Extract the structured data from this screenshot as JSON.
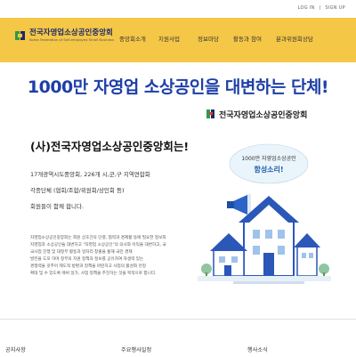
{
  "topbar": {
    "links": [
      "LOG IN",
      "|",
      "SIGN UP"
    ]
  },
  "logo": {
    "title": "전국자영업소상공인중앙회",
    "subtitle": "Korea Federation of Self-employed Small Business",
    "colors": {
      "primary": "#1b2a6b",
      "accent": "#2e9a47"
    }
  },
  "nav": {
    "background": "#f5c747",
    "items": [
      "중앙회소개",
      "지원사업",
      "정보마당",
      "활동과 참여",
      "분과위원회상담"
    ]
  },
  "hero": {
    "title": "1000만 자영업 소상공인을 대변하는 단체!",
    "title_color": "#1e3fa8",
    "org_name": "전국자영업소상공인중앙회"
  },
  "intro": {
    "headline": "(사)전국자영업소상공인중앙회는!",
    "lines": [
      "17개광역시도중앙회, 226개 시,군,구 지역연합회",
      "각종단체 (협회/조합/위원회/상인회 등)",
      "회원들이 함께 합니다."
    ]
  },
  "description": [
    "자영업소상공인중앙회는 회원 상호간의 단결, 협력과 경제활 동에 필요한 정보와",
    "자영업과 소상공인들 대변하고 \"자영업 소상공인\"의 의사와 이익을 대변하고, 국",
    "국사업 진행 및 대정부 활동과 일자리 창출을 통해 국민 경제",
    "발전을 도모 하며 정부의 지원 정책과 정보를 공유하여 자생력 있는",
    "경쟁력을 갖추어 제도적 방편과 정책을 마련하고 사업의 활성화 안정",
    "확대 및 수 있도록 애써 일가, 사업 정책을 추진하는 것을 목적으로 합니다."
  ],
  "illustration": {
    "bubble_line1": "1000만 자영업소상공인",
    "bubble_line2": "함성소리!",
    "icons": [
      "megaphone-icon",
      "house-icon"
    ]
  },
  "bottom_tabs": [
    "공지사항",
    "주요행사일정",
    "행사소식"
  ]
}
